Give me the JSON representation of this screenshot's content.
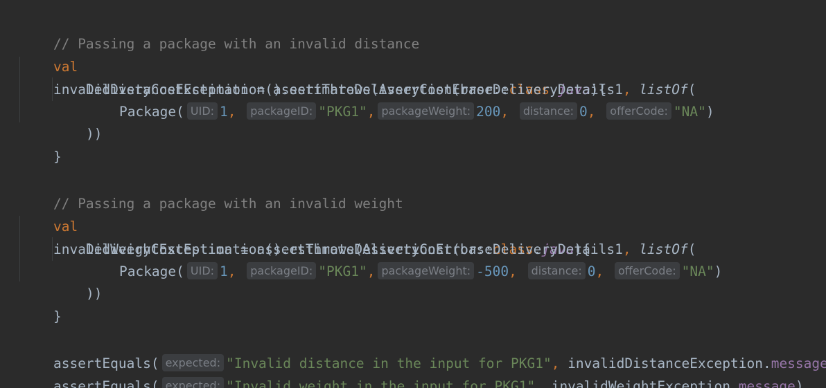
{
  "block1": {
    "comment": "// Passing a package with an invalid distance",
    "val": "val",
    "var_name": "invalidDistanceException",
    "assign": " = ",
    "fn": "assertThrows",
    "open_arg": "(AssertionError::",
    "class_kw": "class",
    "dot": ".",
    "java": "java",
    "close_brace": "){",
    "call_prefix": "DeliveryCostEstimation().estimateDeliveryCost(baseDeliveryDetails1",
    "comma_sep": ", ",
    "list_of": "listOf",
    "paren_open": "(",
    "pkg_prefix": "Package(",
    "uid_hint": "UID:",
    "uid_val": "1",
    "comma1": ", ",
    "packageid_hint": "packageID:",
    "packageid_val": "\"PKG1\"",
    "comma2": ",",
    "weight_hint": "packageWeight:",
    "weight_val": "200",
    "comma3": ", ",
    "distance_hint": "distance:",
    "distance_val": "0",
    "comma4": ", ",
    "offer_hint": "offerCode:",
    "offer_val": "\"NA\"",
    "pkg_close": ")",
    "close_parens": "))",
    "close_block": "}"
  },
  "block2": {
    "comment": "// Passing a package with an invalid weight",
    "val": "val",
    "var_name": "invalidWeightException",
    "assign": " = ",
    "fn": "assertThrows",
    "open_arg": "(AssertionError::",
    "class_kw": "class",
    "dot": ".",
    "java": "java",
    "close_brace": "){",
    "call_prefix": "DeliveryCostEstimation().estimateDeliveryCost(baseDeliveryDetails1",
    "comma_sep": ", ",
    "list_of": "listOf",
    "paren_open": "(",
    "pkg_prefix": "Package(",
    "uid_hint": "UID:",
    "uid_val": "1",
    "comma1": ", ",
    "packageid_hint": "packageID:",
    "packageid_val": "\"PKG1\"",
    "comma2": ",",
    "weight_hint": "packageWeight:",
    "weight_val": "-500",
    "comma3": ", ",
    "distance_hint": "distance:",
    "distance_val": "0",
    "comma4": ", ",
    "offer_hint": "offerCode:",
    "offer_val": "\"NA\"",
    "pkg_close": ")",
    "close_parens": "))",
    "close_block": "}"
  },
  "asserts": [
    {
      "fn": "assertEquals(",
      "hint": "expected:",
      "message": "\"Invalid distance in the input for PKG1\"",
      "sep": ", ",
      "target": "invalidDistanceException",
      "dot": ".",
      "field": "message",
      "close": ")"
    },
    {
      "fn": "assertEquals(",
      "hint": "expected:",
      "message": "\"Invalid weight in the input for PKG1\"",
      "sep": ", ",
      "target": "invalidWeightException",
      "dot": ".",
      "field": "message",
      "close": ")"
    }
  ],
  "colors": {
    "background": "#2b2b2b",
    "text": "#a9b7c6",
    "comment": "#808080",
    "keyword": "#cc7832",
    "string": "#6a8759",
    "number": "#6897bb",
    "field": "#9876aa",
    "hint_bg": "#3b3d40",
    "hint_text": "#7a7e85"
  }
}
